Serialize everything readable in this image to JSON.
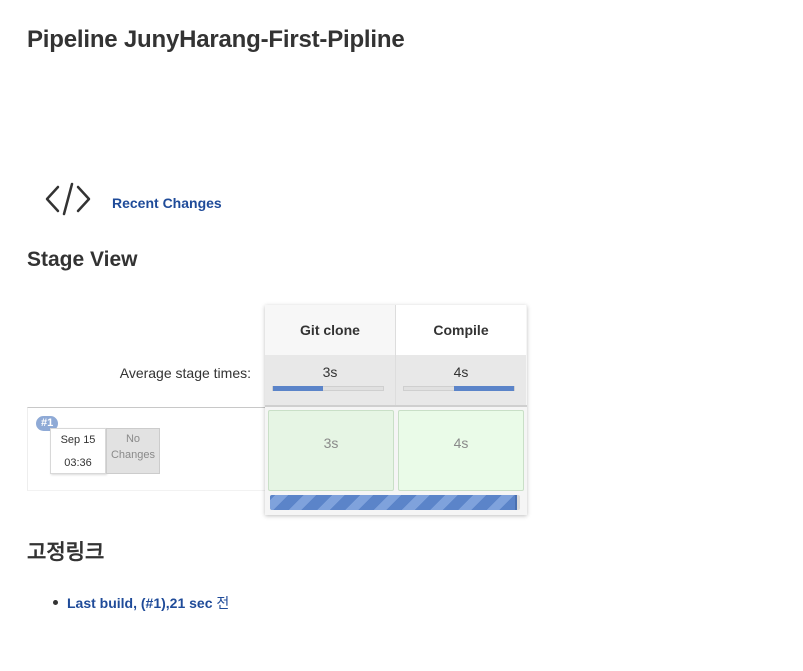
{
  "page": {
    "title": "Pipeline JunyHarang-First-Pipline"
  },
  "changes": {
    "icon": "code-icon",
    "link_label": "Recent Changes"
  },
  "stage_view": {
    "title": "Stage View",
    "avg_label": "Average stage times:",
    "stages": [
      {
        "name": "Git clone",
        "avg_time": "3s",
        "avg_fraction": 0.45,
        "avg_align": "left"
      },
      {
        "name": "Compile",
        "avg_time": "4s",
        "avg_fraction": 0.55,
        "avg_align": "right"
      }
    ],
    "runs": [
      {
        "badge": "#1",
        "date": "Sep 15",
        "time": "03:36",
        "changes_label": "No Changes",
        "cells": [
          "3s",
          "4s"
        ],
        "progress": 0.98
      }
    ],
    "colors": {
      "success_cell": "#e6f5e4",
      "progress": "#5b84c9",
      "badge": "#8faad6"
    }
  },
  "permalinks": {
    "title": "고정링크",
    "items": [
      {
        "link": "Last build, (#1),21 sec",
        "suffix": " 전"
      }
    ]
  }
}
